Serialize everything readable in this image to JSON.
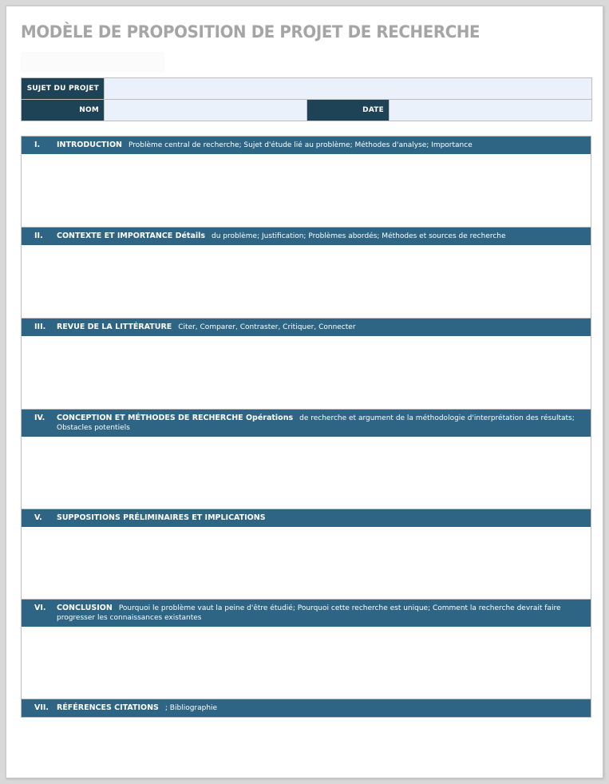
{
  "document": {
    "title": "MODÈLE DE PROPOSITION DE PROJET DE RECHERCHE"
  },
  "info": {
    "subject_label": "SUJET DU PROJET",
    "subject_value": "",
    "name_label": "NOM",
    "name_value": "",
    "date_label": "DATE",
    "date_value": ""
  },
  "colors": {
    "header_dark": "#1f4356",
    "section_header": "#2e6585",
    "field_fill": "#eaf1fa",
    "title_gray": "#a5a5a5"
  },
  "sections": [
    {
      "num": "I.",
      "title": "INTRODUCTION",
      "desc": "Problème central de recherche; Sujet d'étude lié au problème; Méthodes d'analyse; Importance",
      "content": ""
    },
    {
      "num": "II.",
      "title": "CONTEXTE ET IMPORTANCE Détails",
      "desc": "du problème; Justification; Problèmes abordés; Méthodes et sources de recherche",
      "content": ""
    },
    {
      "num": "III.",
      "title": "REVUE DE LA LITTÉRATURE",
      "desc": "Citer, Comparer, Contraster, Critiquer, Connecter",
      "content": ""
    },
    {
      "num": "IV.",
      "title": "CONCEPTION ET MÉTHODES DE RECHERCHE Opérations",
      "desc": "de recherche et argument de la méthodologie d'interprétation des résultats; Obstacles potentiels",
      "content": ""
    },
    {
      "num": "V.",
      "title": "SUPPOSITIONS PRÉLIMINAIRES ET IMPLICATIONS",
      "desc": "",
      "content": ""
    },
    {
      "num": "VI.",
      "title": "CONCLUSION",
      "desc": "Pourquoi le problème vaut la peine d'être étudié; Pourquoi cette recherche est unique; Comment la recherche devrait faire progresser les connaissances existantes",
      "content": ""
    },
    {
      "num": "VII.",
      "title": "RÉFÉRENCES CITATIONS",
      "desc": "; Bibliographie",
      "content": ""
    }
  ]
}
